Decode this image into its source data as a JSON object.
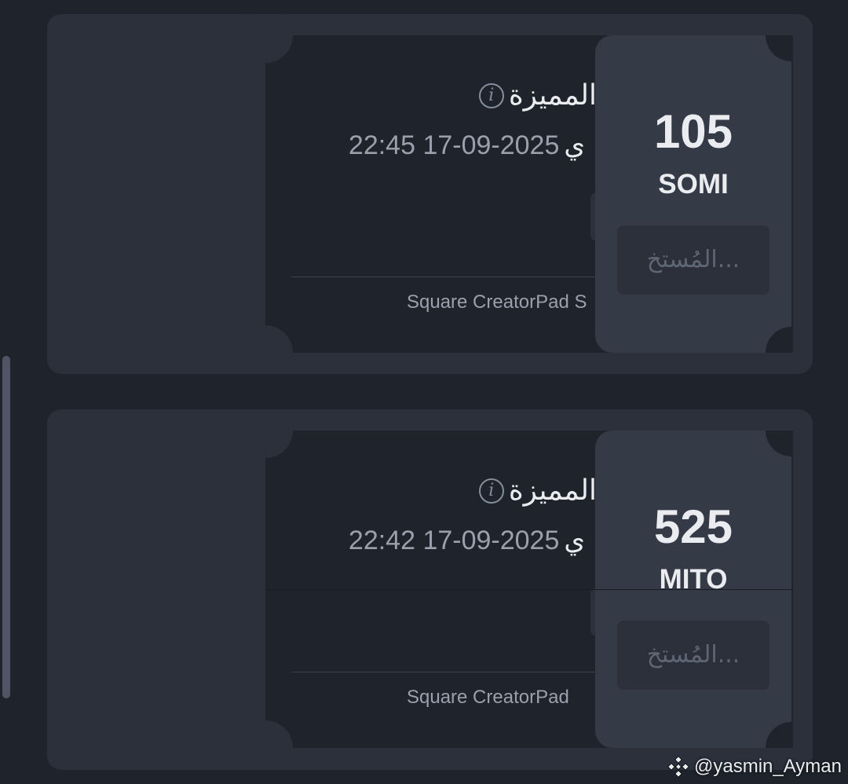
{
  "vouchers": [
    {
      "title": "المميزة",
      "date": "22:45 17-09-2025",
      "date_suffix": "ي",
      "footer": "Square CreatorPad S",
      "amount": "105",
      "token": "SOMI",
      "use_label": "المُستخ..."
    },
    {
      "title": "المميزة",
      "date": "22:42 17-09-2025",
      "date_suffix": "ي",
      "footer": "Square CreatorPad",
      "amount": "525",
      "token": "MITO",
      "use_label": "المُستخ..."
    }
  ],
  "watermark": {
    "handle": "@yasmin_Ayman",
    "icon": "binance-logo"
  },
  "colors": {
    "background": "#1f232b",
    "card": "#2b303b",
    "stub": "#353a47",
    "text_primary": "#eaecef",
    "text_secondary": "#9aa1ad"
  }
}
